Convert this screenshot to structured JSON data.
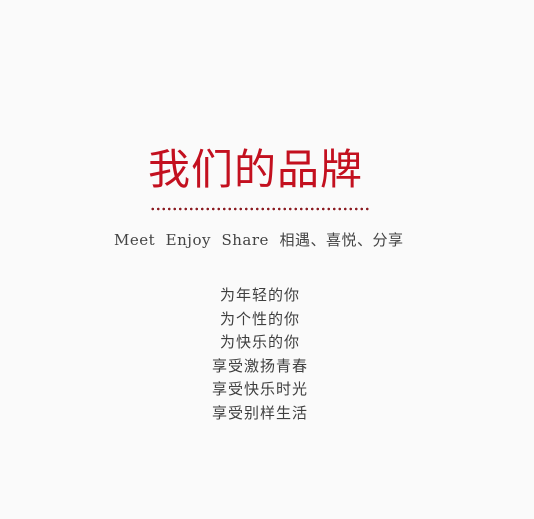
{
  "brand": {
    "title": "我们的品牌",
    "tagline": "Meet  Enjoy  Share  相遇、喜悦、分享",
    "lines": [
      "为年轻的你",
      "为个性的你",
      "为快乐的你",
      "享受激扬青春",
      "享受快乐时光",
      "享受别样生活"
    ]
  },
  "colors": {
    "accent": "#c3101f",
    "divider": "#8a1a20",
    "text": "#444444",
    "background": "#fafafa"
  }
}
